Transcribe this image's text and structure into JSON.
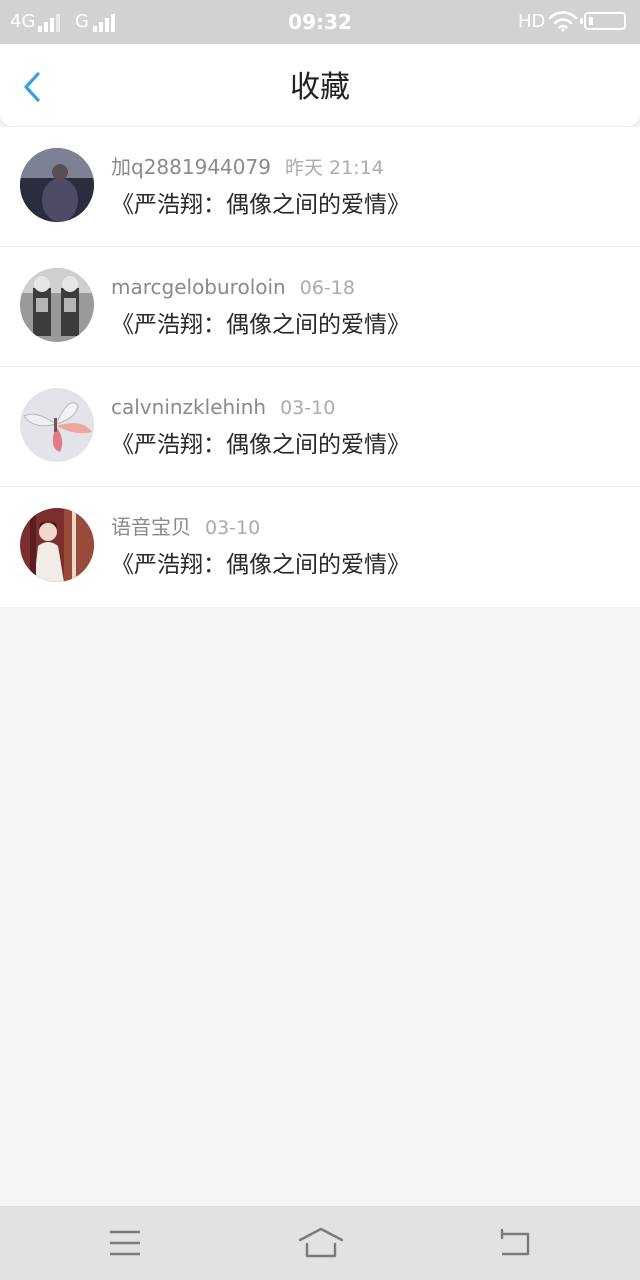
{
  "status_bar": {
    "network_1": "4G",
    "network_2": "G",
    "time": "09:32",
    "hd": "HD"
  },
  "header": {
    "back_icon": "chevron-left-icon",
    "title": "收藏"
  },
  "items": [
    {
      "username": "加q2881944079",
      "time": "昨天 21:14",
      "title": "《严浩翔：偶像之间的爱情》"
    },
    {
      "username": "marcgeloburoloin",
      "time": "06-18",
      "title": "《严浩翔：偶像之间的爱情》"
    },
    {
      "username": "calvninzklehinh",
      "time": "03-10",
      "title": "《严浩翔：偶像之间的爱情》"
    },
    {
      "username": "语音宝贝",
      "time": "03-10",
      "title": "《严浩翔：偶像之间的爱情》"
    }
  ],
  "nav_bar": {
    "menu_icon": "menu-icon",
    "home_icon": "home-icon",
    "back_icon": "back-icon"
  },
  "colors": {
    "accent": "#3a9fe8",
    "status_bar_bg": "#d2d2d2",
    "page_bg": "#f8f5f6",
    "nav_bar_bg": "#e2e2e2"
  }
}
